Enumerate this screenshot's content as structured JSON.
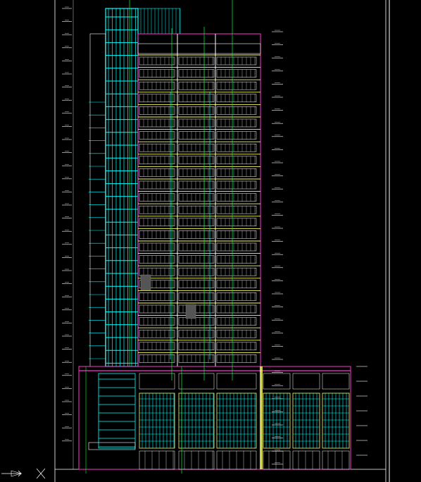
{
  "viewport": {
    "background": "#000000",
    "colors": {
      "frame": "#ffffff",
      "glass_curtain": "#00ffff",
      "facade_lines": "#ffffff",
      "floor_bands": "#ffff66",
      "outline_accent": "#ff33cc",
      "axis_lines": "#00ff33",
      "dim_ticks": "#ffffff"
    },
    "drawing": {
      "type": "CAD building elevation",
      "tower_floors": 25,
      "podium_floors": 4,
      "tower_bays": 3,
      "podium_bays": 6
    },
    "icons": {
      "section_marker": "arrow-marker-icon",
      "north_marker": "cross-marker-icon"
    }
  }
}
